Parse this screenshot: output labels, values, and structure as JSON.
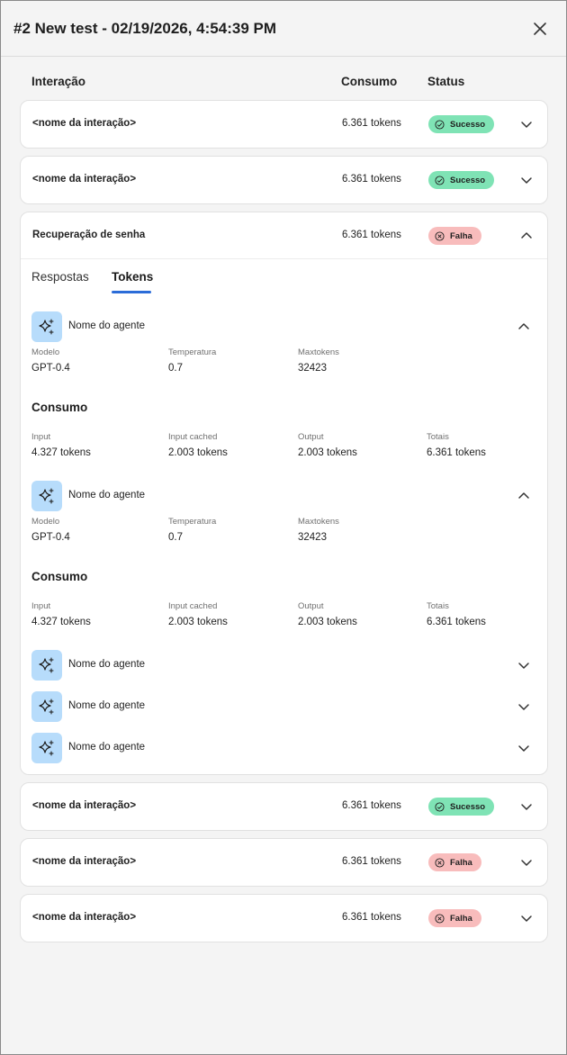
{
  "header": {
    "title": "#2 New test - 02/19/2026, 4:54:39 PM"
  },
  "columns": {
    "interacao": "Interação",
    "consumo": "Consumo",
    "status": "Status"
  },
  "rows": [
    {
      "name": "<nome da interação>",
      "tokens": "6.361 tokens",
      "status": "Sucesso"
    },
    {
      "name": "<nome da interação>",
      "tokens": "6.361 tokens",
      "status": "Sucesso"
    },
    {
      "name": "Recuperação de senha",
      "tokens": "6.361 tokens",
      "status": "Falha"
    },
    {
      "name": "<nome da interação>",
      "tokens": "6.361 tokens",
      "status": "Sucesso"
    },
    {
      "name": "<nome da interação>",
      "tokens": "6.361 tokens",
      "status": "Falha"
    },
    {
      "name": "<nome da interação>",
      "tokens": "6.361 tokens",
      "status": "Falha"
    }
  ],
  "tabs": {
    "respostas": "Respostas",
    "tokens": "Tokens"
  },
  "agents": [
    {
      "name": "Nome do agente",
      "model_label": "Modelo",
      "model": "GPT-0.4",
      "temp_label": "Temperatura",
      "temp": "0.7",
      "max_label": "Maxtokens",
      "max": "32423",
      "consumo_title": "Consumo",
      "input_label": "Input",
      "input": "4.327 tokens",
      "cached_label": "Input cached",
      "cached": "2.003 tokens",
      "output_label": "Output",
      "output": "2.003 tokens",
      "totais_label": "Totais",
      "totais": "6.361 tokens"
    },
    {
      "name": "Nome do agente",
      "model_label": "Modelo",
      "model": "GPT-0.4",
      "temp_label": "Temperatura",
      "temp": "0.7",
      "max_label": "Maxtokens",
      "max": "32423",
      "consumo_title": "Consumo",
      "input_label": "Input",
      "input": "4.327 tokens",
      "cached_label": "Input cached",
      "cached": "2.003 tokens",
      "output_label": "Output",
      "output": "2.003 tokens",
      "totais_label": "Totais",
      "totais": "6.361 tokens"
    },
    {
      "name": "Nome do agente"
    },
    {
      "name": "Nome do agente"
    },
    {
      "name": "Nome do agente"
    }
  ],
  "icons": {
    "close": "close-icon",
    "chevron_down": "chevron-down-icon",
    "chevron_up": "chevron-up-icon",
    "success": "check-circle-icon",
    "fail": "x-circle-icon",
    "agent": "sparkles-icon"
  },
  "colors": {
    "success_badge": "#7fe3b5",
    "fail_badge": "#f8bcbc",
    "agent_icon_bg": "#b7dcfb",
    "tab_accent": "#2b6cd8",
    "background": "#f4f4f4"
  }
}
